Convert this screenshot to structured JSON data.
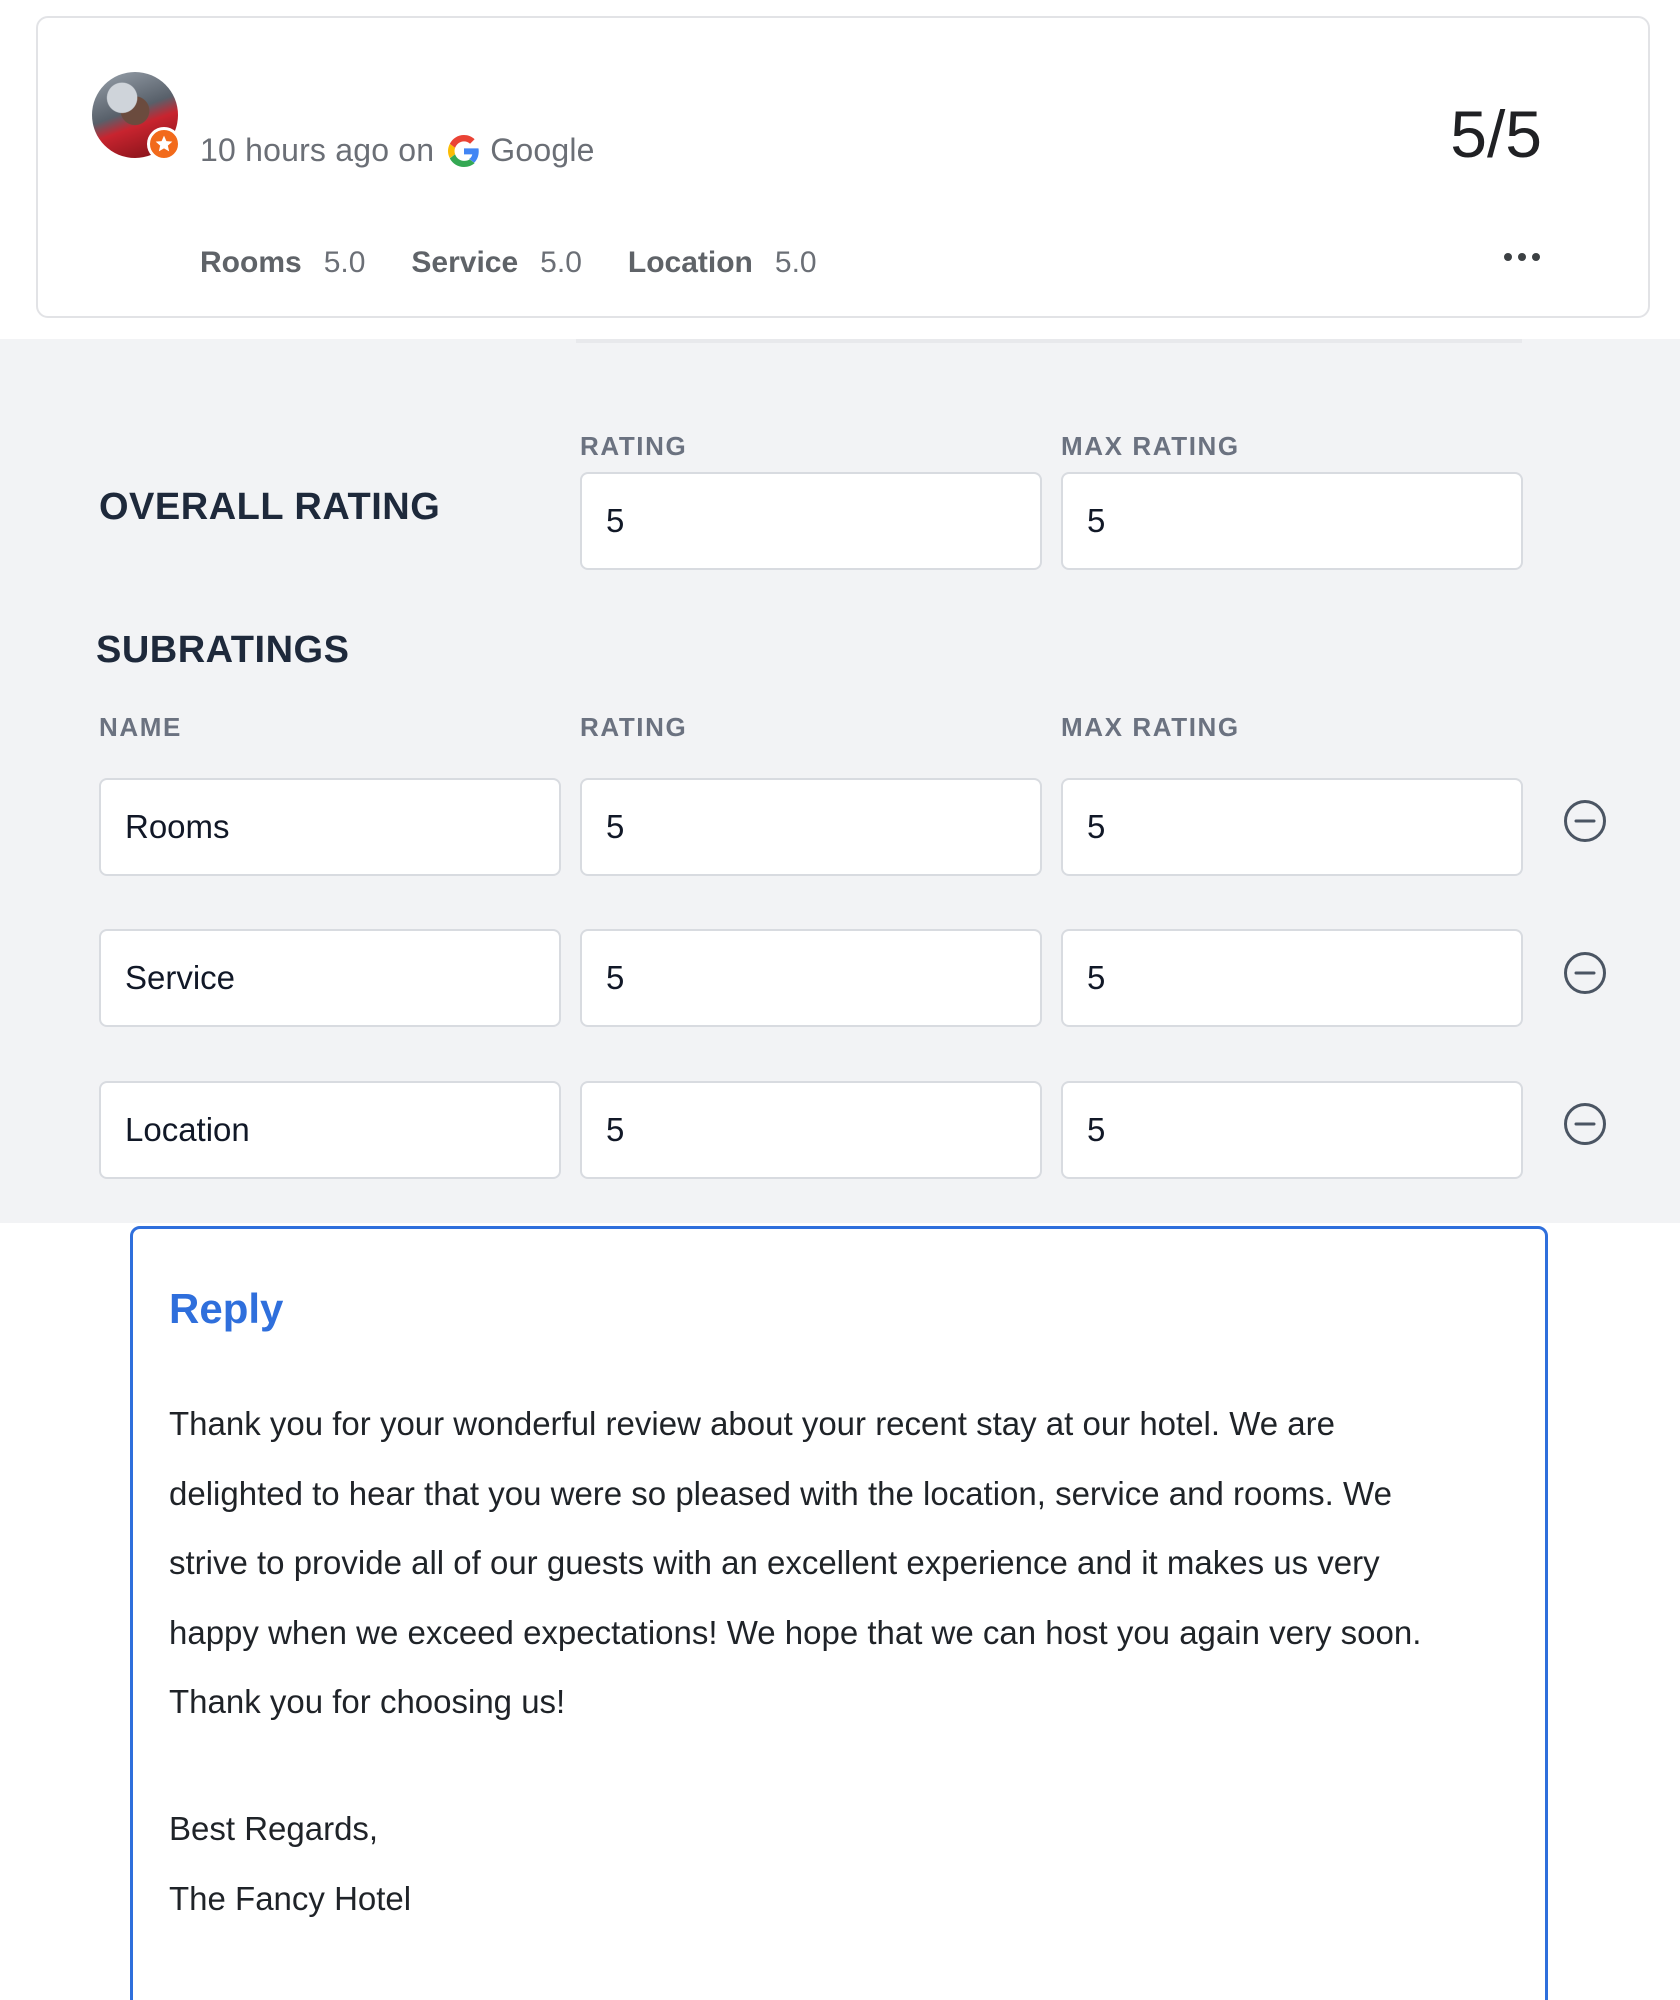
{
  "review": {
    "time_ago": "10 hours ago on",
    "source": "Google",
    "score": "5/5",
    "subscores": [
      {
        "name": "Rooms",
        "value": "5.0"
      },
      {
        "name": "Service",
        "value": "5.0"
      },
      {
        "name": "Location",
        "value": "5.0"
      }
    ],
    "colors": {
      "badge": "#f26a1b"
    }
  },
  "editor": {
    "overall": {
      "title": "OVERALL RATING",
      "rating_label": "RATING",
      "max_rating_label": "MAX RATING",
      "rating": "5",
      "max_rating": "5"
    },
    "subratings": {
      "title": "SUBRATINGS",
      "name_label": "NAME",
      "rating_label": "RATING",
      "max_rating_label": "MAX RATING",
      "rows": [
        {
          "name": "Rooms",
          "rating": "5",
          "max": "5"
        },
        {
          "name": "Service",
          "rating": "5",
          "max": "5"
        },
        {
          "name": "Location",
          "rating": "5",
          "max": "5"
        }
      ]
    }
  },
  "reply": {
    "title": "Reply",
    "accent_color": "#2f6fdc",
    "lines": [
      "Thank you for your wonderful review about your recent stay at our hotel. We are",
      "delighted to hear that you were so pleased with the location, service and rooms. We",
      "strive to provide all of our guests with an excellent experience and it makes us very",
      "happy when we exceed expectations! We hope that we can host you again very soon.",
      "Thank you for choosing us!"
    ],
    "signoff": "Best Regards,",
    "signature": "The Fancy Hotel"
  }
}
